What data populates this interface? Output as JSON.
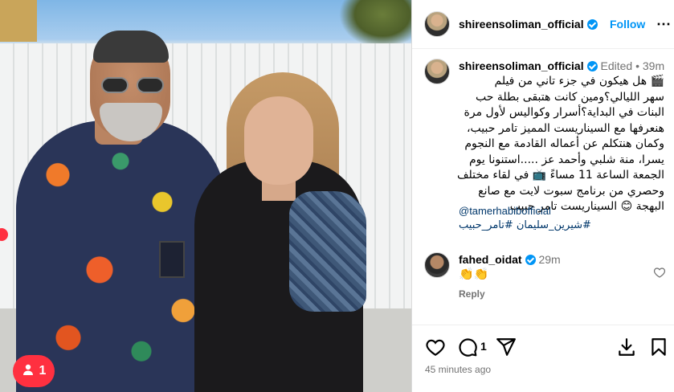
{
  "post": {
    "username": "shireensoliman_official",
    "follow_label": "Follow",
    "more_label": "⋯"
  },
  "caption": {
    "username": "shireensoliman_official",
    "edited_label": "Edited",
    "separator": "•",
    "time": "39m",
    "lines": [
      "🎬 هل هيكون في جزء تاني من فيلم",
      "سهر الليالي؟ومين كانت هتبقى بطلة حب",
      "البنات في البداية؟أسرار وكواليس لأول مرة",
      "هنعرفها مع السيناريست المميز تامر حبيب،",
      "وكمان هنتكلم عن أعماله القادمة مع النجوم",
      "يسرا، منة شلبي وأحمد عز .....استنونا يوم",
      "الجمعة الساعة 11 مساءً 📺 في لقاء مختلف",
      "وحصري من برنامج سبوت لايت مع صانع",
      "البهجة 😊 السيناريست تامر حبيب"
    ],
    "mention": "@tamerhabibofficial",
    "hashtags": "#شيرين_سليمان #تامر_حبيب"
  },
  "comment": {
    "username": "fahed_oidat",
    "time": "29m",
    "text": "👏👏",
    "reply_label": "Reply"
  },
  "actions": {
    "comment_count": "1",
    "timestamp": "45 minutes ago"
  },
  "notification": {
    "count": "1"
  },
  "colors": {
    "accent": "#0095f6",
    "link": "#00376b",
    "badge": "#ff3040",
    "muted": "#737373"
  },
  "icons": [
    "verified-icon",
    "heart-icon",
    "comment-icon",
    "share-icon",
    "download-icon",
    "bookmark-icon",
    "person-icon"
  ]
}
